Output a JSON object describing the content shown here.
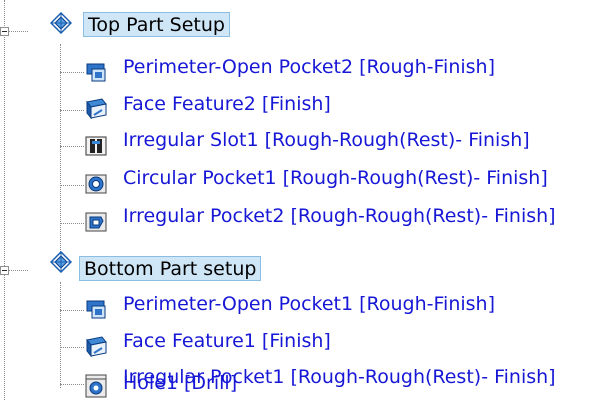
{
  "tree": {
    "setups": [
      {
        "label": "Top Part Setup",
        "icon": "setup-icon",
        "features": [
          {
            "label": "Perimeter-Open Pocket2 [Rough-Finish]",
            "icon": "perimeter-pocket-icon"
          },
          {
            "label": "Face Feature2 [Finish]",
            "icon": "face-feature-icon"
          },
          {
            "label": "Irregular Slot1 [Rough-Rough(Rest)- Finish]",
            "icon": "irregular-slot-icon"
          },
          {
            "label": "Circular Pocket1 [Rough-Rough(Rest)- Finish]",
            "icon": "circular-pocket-icon"
          },
          {
            "label": "Irregular Pocket2 [Rough-Rough(Rest)- Finish]",
            "icon": "irregular-pocket-icon"
          }
        ]
      },
      {
        "label": "Bottom Part setup",
        "icon": "setup-icon",
        "features": [
          {
            "label": "Perimeter-Open Pocket1 [Rough-Finish]",
            "icon": "perimeter-pocket-icon"
          },
          {
            "label": "Face Feature1 [Finish]",
            "icon": "face-feature-icon"
          },
          {
            "label": "Irregular Pocket1 [Rough-Rough(Rest)- Finish]",
            "icon": "irregular-pocket-icon"
          },
          {
            "label": "Hole1 [Drill]",
            "icon": "hole-icon"
          }
        ]
      }
    ]
  },
  "colors": {
    "feature_text": "#1717d6",
    "selection_fill": "#cfe6f7",
    "selection_border": "#8bbde3"
  }
}
